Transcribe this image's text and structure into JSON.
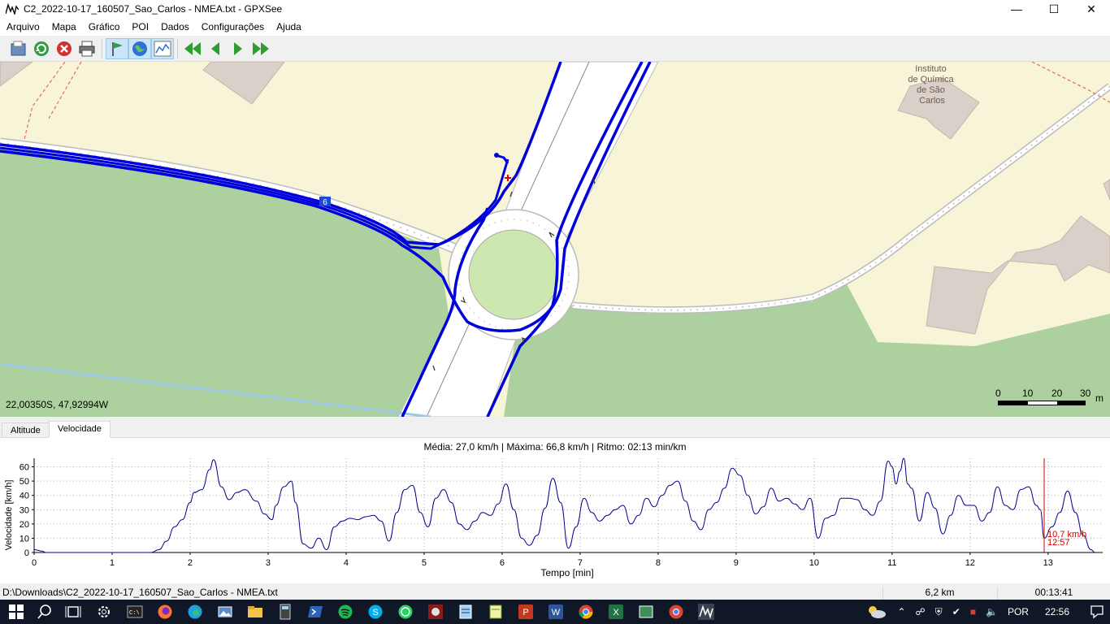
{
  "window": {
    "title": "C2_2022-10-17_160507_Sao_Carlos - NMEA.txt - GPXSee"
  },
  "menu": [
    "Arquivo",
    "Mapa",
    "Gráfico",
    "POI",
    "Dados",
    "Configurações",
    "Ajuda"
  ],
  "toolbar": {
    "icons": [
      "open-icon",
      "reload-icon",
      "close-file-icon",
      "print-icon",
      "show-waypoints-icon",
      "show-map-icon",
      "show-graph-icon",
      "first-file-icon",
      "previous-file-icon",
      "next-file-icon",
      "last-file-icon"
    ]
  },
  "map": {
    "coordinates": "22,00350S, 47,92994W",
    "place_label": [
      "Instituto",
      "de Química",
      "de São",
      "Carlos"
    ],
    "road_ref": "6",
    "scale": {
      "labels": [
        "0",
        "10",
        "20",
        "30"
      ],
      "unit": "m"
    }
  },
  "tabs": {
    "altitude": "Altitude",
    "velocity": "Velocidade"
  },
  "graph": {
    "info": "Média: 27,0 km/h | Máxima: 66,8 km/h | Ritmo: 02:13 min/km",
    "marker_value": "10,7 km/h",
    "marker_time": "12:57"
  },
  "chart_data": {
    "type": "line",
    "xlabel": "Tempo [min]",
    "ylabel": "Velocidade [km/h]",
    "xlim": [
      0,
      13.7
    ],
    "ylim": [
      0,
      66
    ],
    "xticks": [
      "0",
      "1",
      "2",
      "3",
      "4",
      "5",
      "6",
      "7",
      "8",
      "9",
      "10",
      "11",
      "12",
      "13"
    ],
    "yticks": [
      "0",
      "10",
      "20",
      "30",
      "40",
      "50",
      "60"
    ],
    "series": [
      {
        "color": "#00008b",
        "x": [
          0,
          0.1,
          0.15,
          1.5,
          1.6,
          1.7,
          1.8,
          1.9,
          2.0,
          2.05,
          2.15,
          2.25,
          2.3,
          2.4,
          2.5,
          2.6,
          2.7,
          2.85,
          2.95,
          3.05,
          3.1,
          3.2,
          3.3,
          3.35,
          3.45,
          3.55,
          3.65,
          3.75,
          3.85,
          3.95,
          4.05,
          4.15,
          4.25,
          4.35,
          4.45,
          4.55,
          4.65,
          4.75,
          4.85,
          4.95,
          5.05,
          5.15,
          5.25,
          5.35,
          5.45,
          5.55,
          5.65,
          5.75,
          5.85,
          5.95,
          6.05,
          6.15,
          6.25,
          6.35,
          6.45,
          6.55,
          6.65,
          6.75,
          6.85,
          6.95,
          7.05,
          7.15,
          7.25,
          7.35,
          7.45,
          7.55,
          7.65,
          7.75,
          7.85,
          7.95,
          8.05,
          8.15,
          8.25,
          8.35,
          8.45,
          8.55,
          8.65,
          8.75,
          8.85,
          8.95,
          9.05,
          9.15,
          9.25,
          9.35,
          9.45,
          9.55,
          9.65,
          9.75,
          9.85,
          9.95,
          10.05,
          10.15,
          10.25,
          10.35,
          10.45,
          10.55,
          10.65,
          10.75,
          10.85,
          10.95,
          11.0,
          11.05,
          11.1,
          11.15,
          11.2,
          11.25,
          11.35,
          11.45,
          11.55,
          11.65,
          11.75,
          11.85,
          11.95,
          12.05,
          12.15,
          12.25,
          12.35,
          12.45,
          12.55,
          12.65,
          12.75,
          12.85,
          12.9,
          12.95,
          13.05,
          13.15,
          13.25,
          13.35,
          13.45,
          13.55,
          13.6
        ],
        "y": [
          2,
          1,
          0,
          0,
          2,
          8,
          18,
          23,
          35,
          42,
          44,
          58,
          65,
          46,
          37,
          42,
          44,
          36,
          27,
          23,
          33,
          46,
          50,
          35,
          6,
          3,
          10,
          2,
          18,
          22,
          24,
          23,
          25,
          26,
          22,
          8,
          28,
          44,
          47,
          28,
          18,
          38,
          44,
          35,
          20,
          16,
          22,
          28,
          26,
          34,
          48,
          30,
          10,
          5,
          12,
          31,
          52,
          35,
          3,
          18,
          38,
          28,
          22,
          26,
          30,
          33,
          20,
          26,
          38,
          32,
          40,
          47,
          50,
          36,
          22,
          16,
          30,
          35,
          45,
          59,
          54,
          40,
          27,
          32,
          45,
          36,
          38,
          34,
          30,
          38,
          10,
          24,
          26,
          38,
          38,
          37,
          30,
          26,
          36,
          64,
          60,
          48,
          57,
          66,
          48,
          45,
          22,
          42,
          31,
          13,
          26,
          40,
          33,
          33,
          22,
          28,
          46,
          33,
          30,
          44,
          46,
          33,
          30,
          10,
          18,
          28,
          43,
          28,
          12,
          2,
          0
        ]
      }
    ]
  },
  "status": {
    "path": "D:\\Downloads\\C2_2022-10-17_160507_Sao_Carlos - NMEA.txt",
    "distance": "6,2 km",
    "time": "00:13:41"
  },
  "taskbar": {
    "language": "POR",
    "clock": "22:56"
  }
}
